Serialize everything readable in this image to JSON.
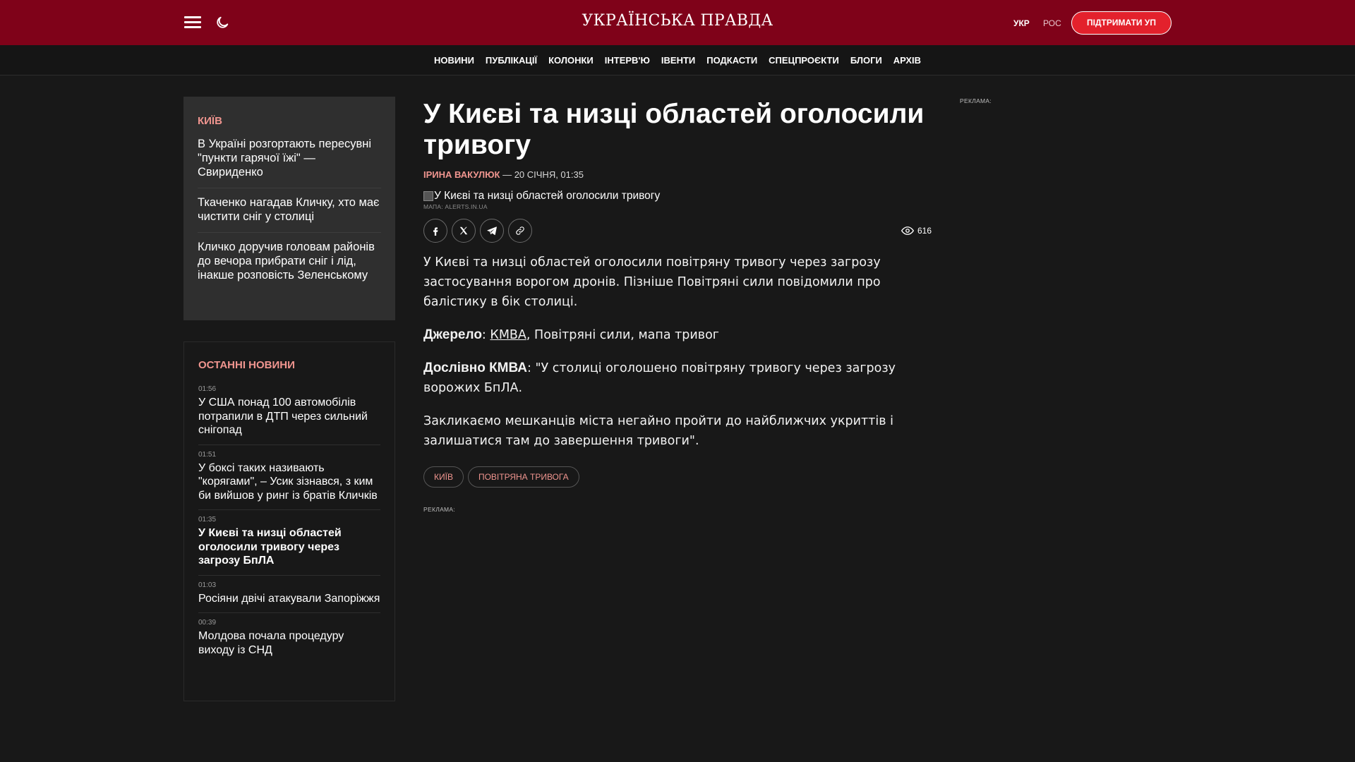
{
  "header": {
    "logo": "УКРАЇНСЬКА ПРАВДА",
    "lang_ukr": "УКР",
    "lang_ros": "РОС",
    "support": "ПІДТРИМАТИ УП",
    "bg_color": "#7f0219"
  },
  "nav": [
    "НОВИНИ",
    "ПУБЛІКАЦІЇ",
    "КОЛОНКИ",
    "ІНТЕРВ'Ю",
    "ІВЕНТИ",
    "ПОДКАСТИ",
    "СПЕЦПРОЄКТИ",
    "БЛОГИ",
    "АРХІВ"
  ],
  "city": {
    "title": "КИЇВ",
    "items": [
      "В Україні розгортають пересувні \"пункти гарячої їжі\" — Свириденко",
      "Ткаченко нагадав Кличку, хто має чистити сніг у столиці",
      "Кличко доручив головам районів до вечора прибрати сніг і лід, інакше розповість Зеленському"
    ]
  },
  "latest": {
    "title": "ОСТАННІ НОВИНИ",
    "items": [
      {
        "time": "01:56",
        "text": "У США понад 100 автомобілів потрапили в ДТП через сильний снігопад"
      },
      {
        "time": "01:51",
        "text": "У боксі таких називають \"корягами\", – Усик зізнався, з ким би вийшов у ринг із братів Кличків"
      },
      {
        "time": "01:35",
        "text": "У Києві та низці областей оголосили тривогу через загрозу БпЛА"
      },
      {
        "time": "01:03",
        "text": "Росіяни двічі атакували Запоріжжя"
      },
      {
        "time": "00:39",
        "text": "Молдова почала процедуру виходу із СНД"
      }
    ]
  },
  "article": {
    "title": "У Києві та низці областей оголосили тривогу",
    "author": "ІРИНА ВАКУЛЮК",
    "date": " — 20 СІЧНЯ, 01:35",
    "image_alt": "У Києві та низці областей оголосили тривогу",
    "image_credit": "МАПА: ALERTS.IN.UA",
    "views": "616",
    "p1": "У Києві та низці областей оголосили повітряну тривогу через загрозу застосування ворогом дронів. Пізніше Повітряні сили повідомили про балістику в бік столиці.",
    "source_label": "Джерело",
    "source_colon": ": ",
    "source_link": "КМВА",
    "source_rest": ", Повітряні сили, мапа тривог",
    "quote_label": "Дослівно КМВА",
    "quote_text": ": \"У столиці оголошено повітряну тривогу через загрозу ворожих БпЛА.",
    "p4": "Закликаємо мешканців міста негайно пройти до найближчих укриттів і залишатися там до завершення тривоги\".",
    "tags": [
      "КИЇВ",
      "ПОВІТРЯНА ТРИВОГА"
    ]
  },
  "ads": {
    "label": "РЕКЛАМА:"
  }
}
